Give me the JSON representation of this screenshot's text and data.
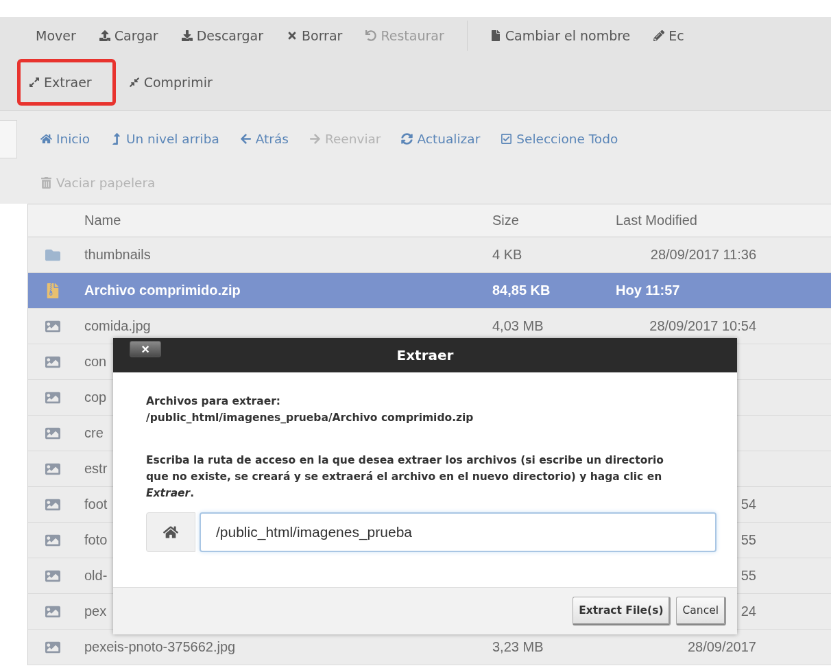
{
  "toolbar": {
    "rows": [
      {
        "items": [
          {
            "kind": "button",
            "label": "Mover",
            "disabled": false,
            "highlighted": false
          },
          {
            "kind": "button",
            "label": "Cargar",
            "disabled": false,
            "highlighted": false
          },
          {
            "kind": "button",
            "label": "Descargar",
            "disabled": false,
            "highlighted": false
          },
          {
            "kind": "button",
            "label": "Borrar",
            "disabled": false,
            "highlighted": false
          },
          {
            "kind": "button",
            "label": "Restaurar",
            "disabled": true,
            "highlighted": false
          },
          {
            "kind": "separator"
          },
          {
            "kind": "button",
            "label": "Cambiar el nombre",
            "disabled": false,
            "highlighted": false
          },
          {
            "kind": "button",
            "label": "Ec",
            "disabled": false,
            "highlighted": false
          }
        ]
      },
      {
        "items": [
          {
            "kind": "button",
            "label": "Extraer",
            "disabled": false,
            "highlighted": true
          },
          {
            "kind": "button",
            "label": "Comprimir",
            "disabled": false,
            "highlighted": false
          }
        ]
      }
    ]
  },
  "navigation": {
    "rows": [
      {
        "items": [
          {
            "label": "Inicio",
            "disabled": false
          },
          {
            "label": "Un nivel arriba",
            "disabled": false
          },
          {
            "label": "Atrás",
            "disabled": false
          },
          {
            "label": "Reenviar",
            "disabled": true
          },
          {
            "label": "Actualizar",
            "disabled": false
          },
          {
            "label": "Seleccione Todo",
            "disabled": false
          }
        ]
      },
      {
        "items": [
          {
            "label": "Vaciar papelera",
            "disabled": true
          }
        ]
      }
    ]
  },
  "table": {
    "columns": [
      "Name",
      "Size",
      "Last Modified"
    ],
    "rows": [
      {
        "kind": "folder",
        "name": "thumbnails",
        "size": "4 KB",
        "modified": "28/09/2017 11:36",
        "selected": false
      },
      {
        "kind": "archive",
        "name": "Archivo comprimido.zip",
        "size": "84,85 KB",
        "modified": "Hoy 11:57",
        "selected": true
      },
      {
        "kind": "image",
        "name": "comida.jpg",
        "size": "4,03 MB",
        "modified": "28/09/2017 10:54",
        "selected": false
      },
      {
        "kind": "image",
        "name": "con",
        "selected": false
      },
      {
        "kind": "image",
        "name": "cop",
        "selected": false
      },
      {
        "kind": "image",
        "name": "cre",
        "selected": false
      },
      {
        "kind": "image",
        "name": "estr",
        "selected": false
      },
      {
        "kind": "image",
        "name": "foot",
        "modified": "54",
        "selected": false
      },
      {
        "kind": "image",
        "name": "foto",
        "modified": "55",
        "selected": false
      },
      {
        "kind": "image",
        "name": "old-",
        "modified": "55",
        "selected": false
      },
      {
        "kind": "image",
        "name": "pex",
        "modified": "24",
        "selected": false
      },
      {
        "kind": "image",
        "name": "pexeis-pnoto-375662.jpg",
        "size": "3,23 MB",
        "modified": "28/09/2017",
        "selected": false
      }
    ]
  },
  "dialog": {
    "close": "×",
    "title": "Extraer",
    "files_label": "Archivos para extraer:",
    "files_path": "/public_html/imagenes_prueba/Archivo comprimido.zip",
    "instructions": "Escriba la ruta de acceso en la que desea extraer los archivos (si escribe un directorio que no existe, se creará y se extraerá el archivo en el nuevo directorio) y haga clic en *Extraer*.",
    "path_value": "/public_html/imagenes_prueba",
    "buttons": [
      "Extract File(s)",
      "Cancel"
    ]
  }
}
